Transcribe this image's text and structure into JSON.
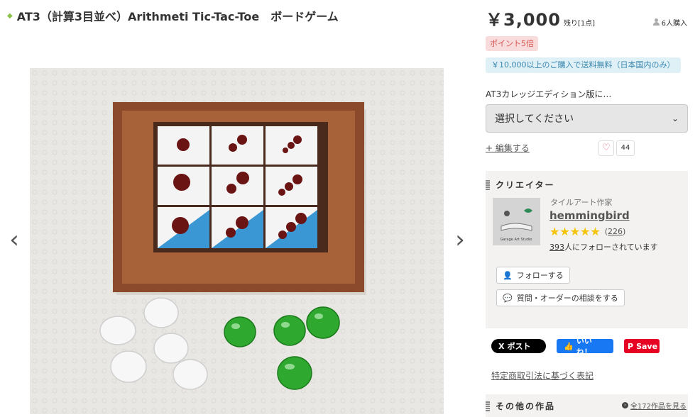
{
  "product": {
    "title": "AT3（計算3目並べ）Arithmeti Tic-Tac-Toe　ボードゲーム",
    "price": "￥3,000",
    "stock": "残り[1点]",
    "buyers": "6人購入",
    "badge_points": "ポイント5倍",
    "badge_shipping": "￥10,000以上のご購入で送料無料（日本国内のみ）",
    "option_label": "AT3カレッジエディション版に…",
    "select_placeholder": "選択してください",
    "edit_link": "+ 編集する",
    "favorite_count": "44"
  },
  "gallery": {
    "prev_arrow": "‹",
    "next_arrow": "›"
  },
  "creator": {
    "section_title": "クリエイター",
    "type": "タイルアート作家",
    "name": "hemmingbird",
    "stars": "★★★★★",
    "rating": 5,
    "review_open": "(",
    "review_count": "226",
    "review_close": ")",
    "followers_count": "393",
    "followers_text": "人にフォローされています",
    "follow_button": "フォローする",
    "consult_button": "質問・オーダーの相談をする",
    "thumb_text": "Garage Art Studio"
  },
  "share": {
    "x_label": "ポスト",
    "x_icon": "X",
    "fb_label": "いいね！",
    "pin_label": "Save",
    "pin_icon": "P"
  },
  "legal_link": "特定商取引法に基づく表記",
  "other_works": {
    "section_title": "その他の作品",
    "see_all": "全172作品を見る"
  },
  "colors": {
    "accent_red": "#d9534f",
    "star": "#f5c400",
    "info_blue": "#3a87ad"
  }
}
